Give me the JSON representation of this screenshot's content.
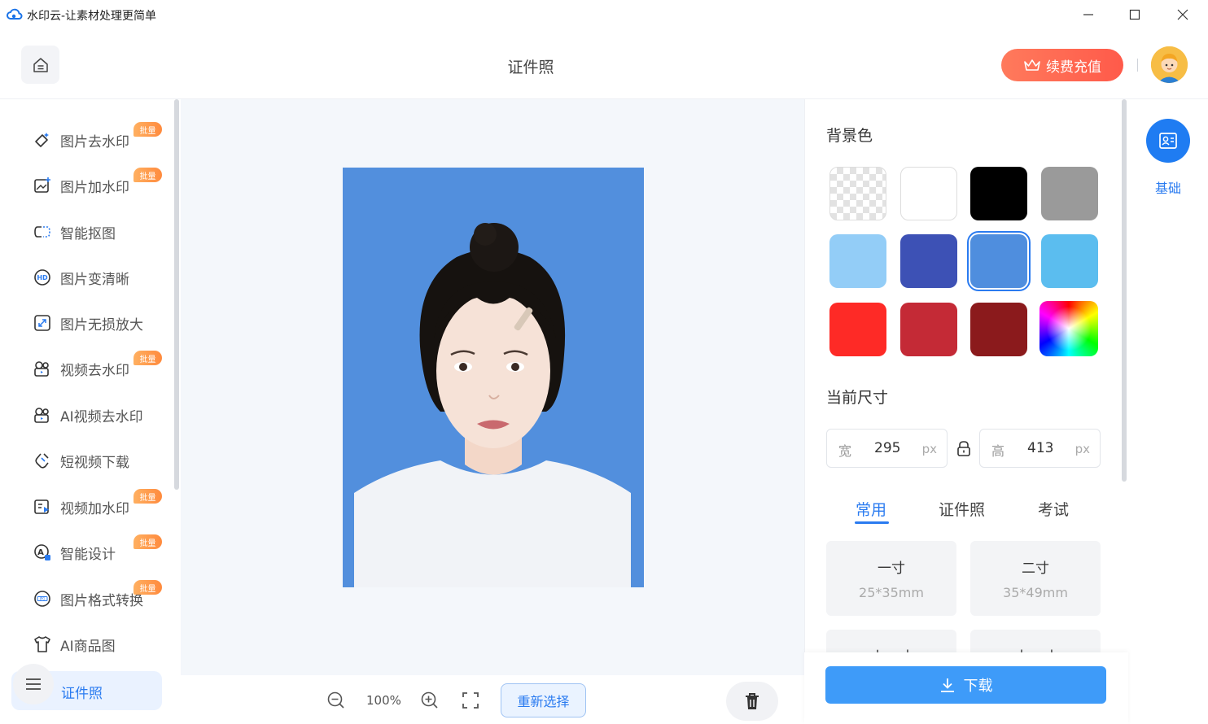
{
  "window": {
    "title": "水印云-让素材处理更简单"
  },
  "header": {
    "title": "证件照",
    "renew_label": "续费充值"
  },
  "sidebar": {
    "items": [
      {
        "label": "图片去水印",
        "badge": "批量",
        "icon": "eraser-icon"
      },
      {
        "label": "图片加水印",
        "badge": "批量",
        "icon": "image-add-icon"
      },
      {
        "label": "智能抠图",
        "badge": "",
        "icon": "cutout-icon"
      },
      {
        "label": "图片变清晰",
        "badge": "",
        "icon": "hd-icon"
      },
      {
        "label": "图片无损放大",
        "badge": "",
        "icon": "enlarge-icon"
      },
      {
        "label": "视频去水印",
        "badge": "批量",
        "icon": "video-eraser-icon"
      },
      {
        "label": "AI视频去水印",
        "badge": "",
        "icon": "ai-video-icon"
      },
      {
        "label": "短视频下载",
        "badge": "",
        "icon": "link-icon"
      },
      {
        "label": "视频加水印",
        "badge": "批量",
        "icon": "video-add-icon"
      },
      {
        "label": "智能设计",
        "badge": "批量",
        "icon": "design-icon"
      },
      {
        "label": "图片格式转换",
        "badge": "批量",
        "icon": "jpg-icon"
      },
      {
        "label": "AI商品图",
        "badge": "",
        "icon": "shirt-icon"
      }
    ],
    "active_label": "证件照"
  },
  "canvas": {
    "zoom": "100%",
    "reselect_label": "重新选择"
  },
  "panel": {
    "bg_title": "背景色",
    "colors": [
      "transparent",
      "#ffffff",
      "#000000",
      "#9a9a9a",
      "#93cdf7",
      "#3d51b5",
      "#4f8ede",
      "#5bbdef",
      "#fe2a26",
      "#c42a36",
      "#8b1a1c",
      "spectrum"
    ],
    "selected_color_index": 6,
    "size_title": "当前尺寸",
    "width_label": "宽",
    "width_value": "295",
    "height_label": "高",
    "height_value": "413",
    "unit": "px",
    "tabs": [
      "常用",
      "证件照",
      "考试"
    ],
    "active_tab": 0,
    "sizes": [
      {
        "name": "一寸",
        "dims": "25*35mm"
      },
      {
        "name": "二寸",
        "dims": "35*49mm"
      },
      {
        "name": "小一寸",
        "dims": ""
      },
      {
        "name": "大一寸",
        "dims": ""
      }
    ],
    "download_label": "下载"
  },
  "rail": {
    "label": "基础"
  }
}
